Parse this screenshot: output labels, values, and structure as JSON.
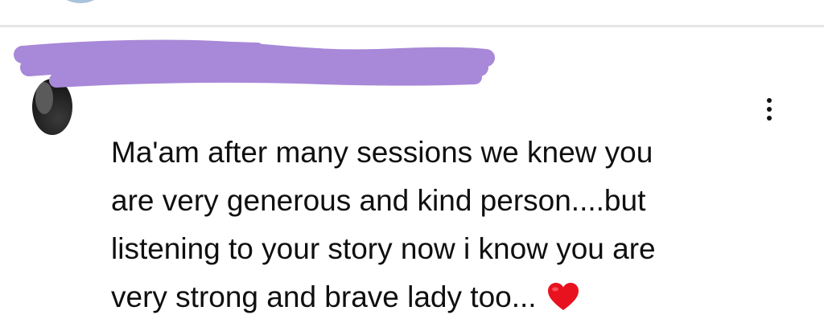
{
  "comment": {
    "author": "",
    "text_lines": [
      "Ma'am after many sessions we knew you",
      "are very generous and kind person....but",
      "listening to your story now i know you are",
      "very strong and brave lady too..."
    ],
    "emoji": "heart-icon",
    "menu_icon": "more-vertical-icon"
  },
  "colors": {
    "redaction": "#a888d8",
    "heart": "#e8121e",
    "divider": "#e6e6e6",
    "text": "#0f0f0f"
  }
}
